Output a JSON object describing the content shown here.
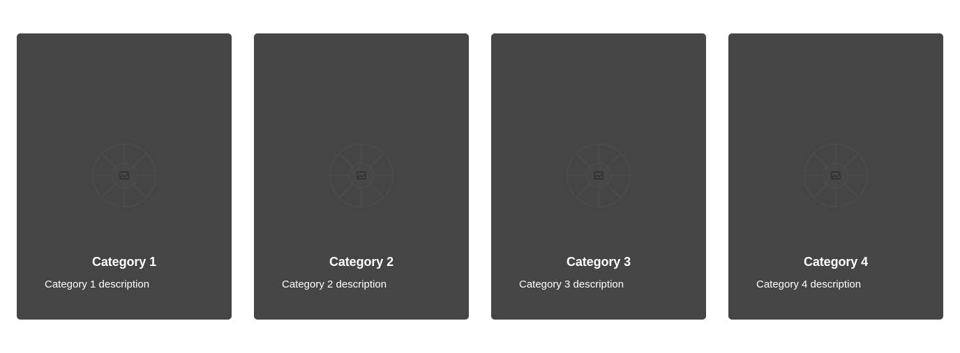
{
  "categories": [
    {
      "title": "Category 1",
      "description": "Category 1 description",
      "image": "image-placeholder-icon"
    },
    {
      "title": "Category 2",
      "description": "Category 2 description",
      "image": "image-placeholder-icon"
    },
    {
      "title": "Category 3",
      "description": "Category 3 description",
      "image": "image-placeholder-icon"
    },
    {
      "title": "Category 4",
      "description": "Category 4 description",
      "image": "image-placeholder-icon"
    }
  ],
  "colors": {
    "card_background": "#454545",
    "text": "#ffffff",
    "page_background": "#ffffff"
  }
}
